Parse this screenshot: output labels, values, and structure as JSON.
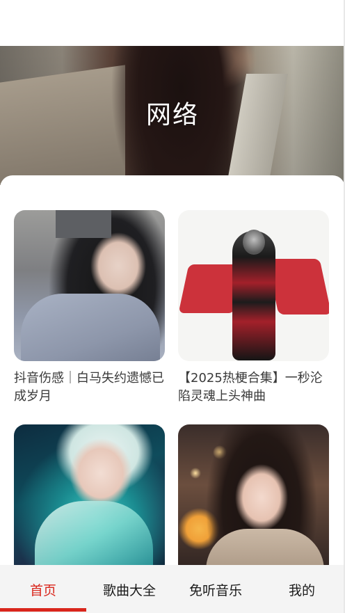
{
  "banner": {
    "title": "网络"
  },
  "items": [
    {
      "title": "抖音伤感｜白马失约遗憾已成岁月"
    },
    {
      "title": "【2025热梗合集】一秒沦陷灵魂上头神曲"
    },
    {
      "title": ""
    },
    {
      "title": ""
    }
  ],
  "tabs": [
    {
      "label": "首页",
      "active": true
    },
    {
      "label": "歌曲大全",
      "active": false
    },
    {
      "label": "免听音乐",
      "active": false
    },
    {
      "label": "我的",
      "active": false
    }
  ],
  "colors": {
    "accent": "#d9261c",
    "tab_bg": "#f4f4f4"
  }
}
